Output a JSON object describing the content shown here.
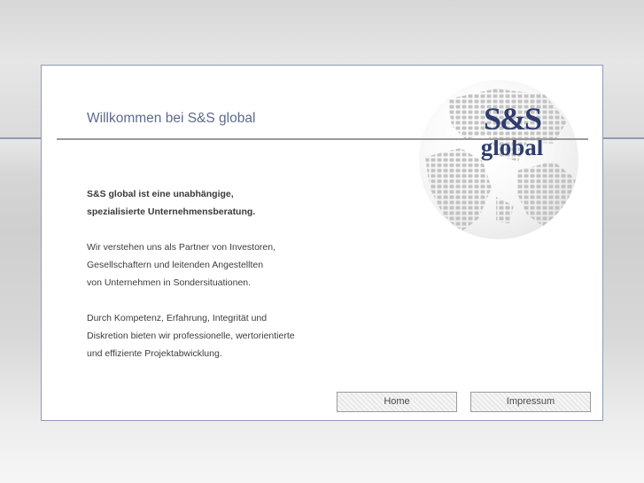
{
  "header": {
    "title": "Willkommen bei S&S global"
  },
  "logo": {
    "line1": "S&S",
    "line2": "global"
  },
  "content": {
    "intro": [
      "S&S global ist eine unabhängige,",
      "spezialisierte Unternehmensberatung."
    ],
    "paragraph1": [
      "Wir verstehen uns als Partner von Investoren,",
      "Gesellschaftern und leitenden Angestellten",
      "von Unternehmen in Sondersituationen."
    ],
    "paragraph2": [
      "Durch Kompetenz, Erfahrung, Integrität und",
      "Diskretion bieten wir professionelle, wertorientierte",
      "und effiziente Projektabwicklung."
    ]
  },
  "nav": {
    "home_label": "Home",
    "impressum_label": "Impressum"
  },
  "colors": {
    "accent": "#5d6a8c",
    "logo": "#2f3d6e",
    "border": "#8e9ab6"
  }
}
